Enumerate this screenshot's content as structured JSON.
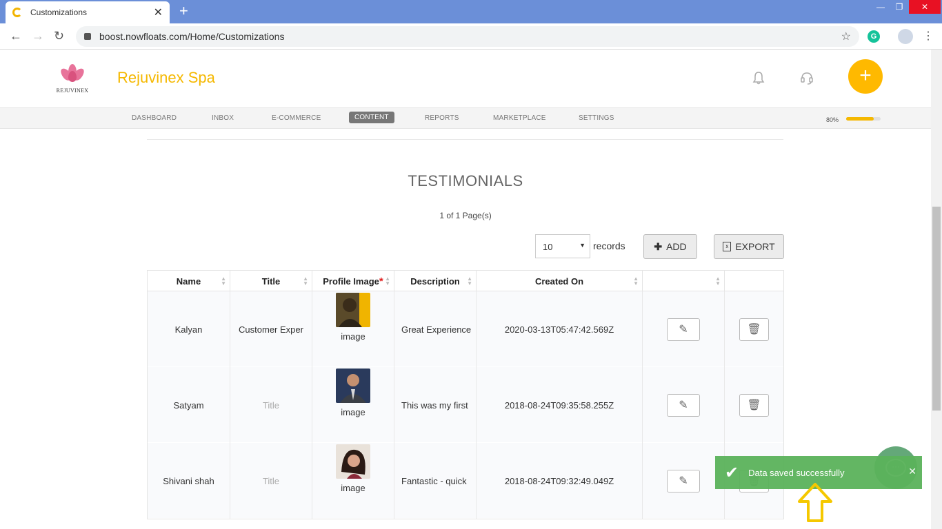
{
  "browser": {
    "tab_title": "Customizations",
    "tab_close": "✕",
    "new_tab": "+",
    "url": "boost.nowfloats.com/Home/Customizations",
    "window_controls": [
      "—",
      "❐",
      "✕"
    ]
  },
  "header": {
    "logo_text": "REJUVINEX",
    "brand": "Rejuvinex Spa",
    "fab_label": "+"
  },
  "menu": {
    "items": [
      "DASHBOARD",
      "INBOX",
      "E-COMMERCE",
      "CONTENT",
      "REPORTS",
      "MARKETPLACE",
      "SETTINGS"
    ],
    "active": "CONTENT",
    "progress_label": "80%",
    "progress_value": 0.8
  },
  "content": {
    "title": "TESTIMONIALS",
    "pages": "1 of 1 Page(s)",
    "records_select": "10",
    "records_label": "records",
    "add_label": "ADD",
    "export_label": "EXPORT"
  },
  "table": {
    "headers": [
      "Name",
      "Title",
      "Profile Image",
      "Description",
      "Created On",
      "",
      ""
    ],
    "image_caption": "image",
    "rows": [
      {
        "name": "Kalyan",
        "title": "Customer Exper",
        "description": "Great Experience",
        "created": "2020-03-13T05:47:42.569Z"
      },
      {
        "name": "Satyam",
        "title": "Title",
        "description": "This was my first",
        "created": "2018-08-24T09:35:58.255Z"
      },
      {
        "name": "Shivani shah",
        "title": "Title",
        "description": "Fantastic - quick",
        "created": "2018-08-24T09:32:49.049Z"
      }
    ]
  },
  "toast": {
    "message": "Data saved successfully",
    "close": "✕"
  },
  "colors": {
    "accent": "#f5b800",
    "toast": "#5bb35b",
    "tabbar": "#6b8fd8"
  }
}
